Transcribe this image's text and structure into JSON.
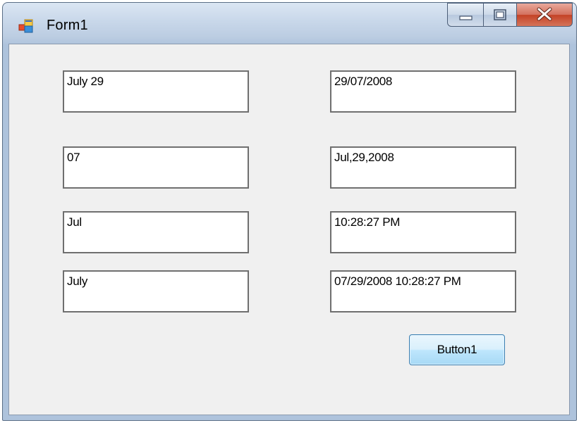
{
  "window": {
    "title": "Form1",
    "controls": {
      "minimize_icon": "minimize-icon",
      "maximize_icon": "maximize-icon",
      "close_icon": "close-icon"
    }
  },
  "textboxes": {
    "left": [
      "July 29",
      "07",
      "Jul",
      "July"
    ],
    "right": [
      "29/07/2008",
      "Jul,29,2008",
      "10:28:27 PM",
      "07/29/2008  10:28:27 PM"
    ]
  },
  "button1": {
    "label": "Button1"
  },
  "colors": {
    "client_bg": "#f0f0f0",
    "close_button": "#c44226",
    "button_border": "#3c7fb1"
  }
}
